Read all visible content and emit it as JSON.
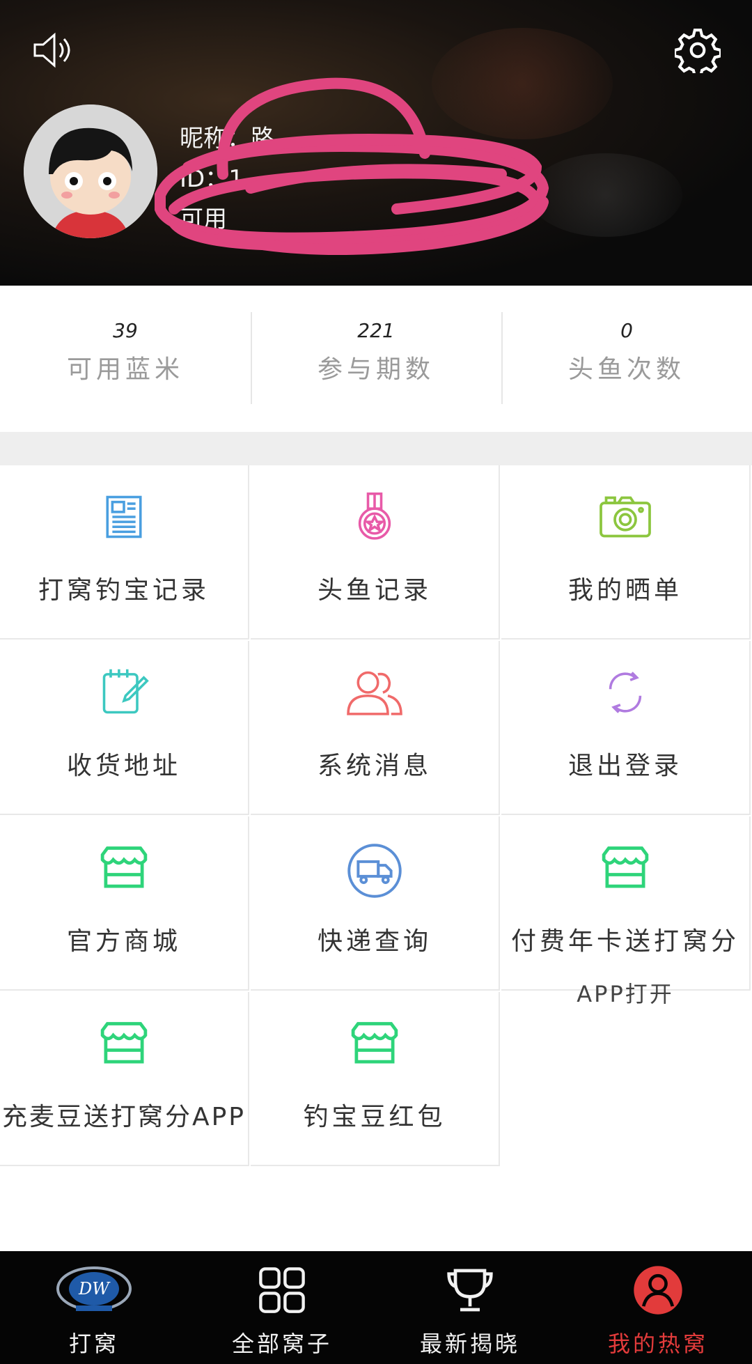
{
  "header": {
    "profile_lines": [
      "昵称：路",
      "ID：1",
      "可用"
    ]
  },
  "stats": [
    {
      "value": "39",
      "label": "可用蓝米"
    },
    {
      "value": "221",
      "label": "参与期数"
    },
    {
      "value": "0",
      "label": "头鱼次数"
    }
  ],
  "menu": [
    {
      "label": "打窝钓宝记录",
      "icon": "document-icon",
      "color": "#4a9fe0"
    },
    {
      "label": "头鱼记录",
      "icon": "medal-icon",
      "color": "#e85aa8"
    },
    {
      "label": "我的晒单",
      "icon": "camera-icon",
      "color": "#8cc63f"
    },
    {
      "label": "收货地址",
      "icon": "edit-note-icon",
      "color": "#3cc8c0"
    },
    {
      "label": "系统消息",
      "icon": "users-icon",
      "color": "#f06a6a"
    },
    {
      "label": "退出登录",
      "icon": "refresh-icon",
      "color": "#b07be0"
    },
    {
      "label": "官方商城",
      "icon": "store-icon",
      "color": "#2ed47a"
    },
    {
      "label": "快递查询",
      "icon": "truck-icon",
      "color": "#5b8fd6"
    },
    {
      "label": "付费年卡送打窝分",
      "label2": "APP打开",
      "icon": "store-icon",
      "color": "#2ed47a"
    },
    {
      "label": "充麦豆送打窝分APP",
      "icon": "store-icon",
      "color": "#2ed47a"
    },
    {
      "label": "钓宝豆红包",
      "icon": "store-icon",
      "color": "#2ed47a"
    }
  ],
  "tabs": [
    {
      "label": "打窝",
      "icon": "logo-icon"
    },
    {
      "label": "全部窝子",
      "icon": "grid-icon"
    },
    {
      "label": "最新揭晓",
      "icon": "trophy-icon"
    },
    {
      "label": "我的热窝",
      "icon": "user-icon",
      "active": true
    }
  ],
  "colors": {
    "accent_red": "#e23b3b",
    "scribble": "#e0457f"
  }
}
